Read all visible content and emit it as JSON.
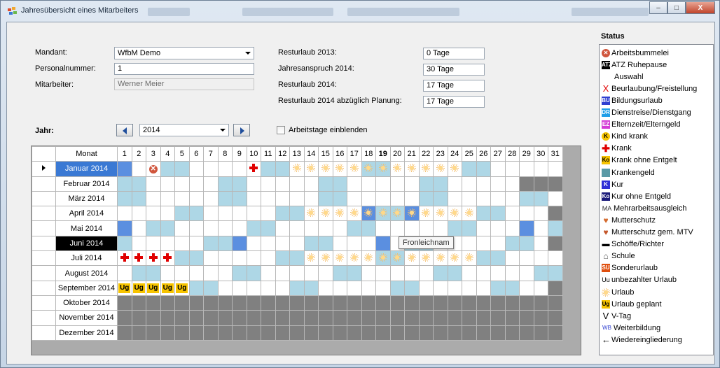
{
  "window": {
    "title": "Jahresübersicht eines Mitarbeiters",
    "controls": {
      "minimize": "–",
      "maximize": "□",
      "close": "X"
    }
  },
  "form": {
    "mandant_label": "Mandant:",
    "mandant_value": "WfbM Demo",
    "personalnummer_label": "Personalnummer:",
    "personalnummer_value": "1",
    "mitarbeiter_label": "Mitarbeiter:",
    "mitarbeiter_value": "Werner Meier",
    "resturlaub_prev_label": "Resturlaub 2013:",
    "resturlaub_prev_value": "0 Tage",
    "jahresanspruch_label": "Jahresanspruch 2014:",
    "jahresanspruch_value": "30 Tage",
    "resturlaub_label": "Resturlaub 2014:",
    "resturlaub_value": "17 Tage",
    "resturlaub_planung_label": "Resturlaub 2014 abzüglich Planung:",
    "resturlaub_planung_value": "17 Tage",
    "jahr_label": "Jahr:",
    "jahr_value": "2014",
    "arbeitstage_label": "Arbeitstage einblenden",
    "arbeitstage_checked": false
  },
  "grid": {
    "month_header": "Monat",
    "days": [
      "1",
      "2",
      "3",
      "4",
      "5",
      "6",
      "7",
      "8",
      "9",
      "10",
      "11",
      "12",
      "13",
      "14",
      "15",
      "16",
      "17",
      "18",
      "19",
      "20",
      "21",
      "22",
      "23",
      "24",
      "25",
      "26",
      "27",
      "28",
      "29",
      "30",
      "31"
    ],
    "current_day": "19",
    "months": [
      {
        "name": "Januar 2014",
        "days_in_month": 31,
        "weekend": [
          4,
          5,
          11,
          12,
          18,
          19,
          25,
          26
        ],
        "marks": {
          "1": "dblue",
          "3": "bummel",
          "10": "krank",
          "13": "urlaub",
          "14": "urlaub",
          "15": "urlaub",
          "16": "urlaub",
          "17": "urlaub",
          "18": "urlaub",
          "19": "urlaub",
          "20": "urlaub",
          "21": "urlaub",
          "22": "urlaub",
          "23": "urlaub",
          "24": "urlaub"
        }
      },
      {
        "name": "Februar 2014",
        "days_in_month": 28,
        "weekend": [
          1,
          2,
          8,
          9,
          15,
          16,
          22,
          23
        ],
        "marks": {}
      },
      {
        "name": "März 2014",
        "days_in_month": 31,
        "weekend": [
          1,
          2,
          8,
          9,
          15,
          16,
          22,
          23,
          29,
          30
        ],
        "marks": {}
      },
      {
        "name": "April 2014",
        "days_in_month": 30,
        "weekend": [
          5,
          6,
          12,
          13,
          19,
          20,
          26,
          27
        ],
        "marks": {
          "14": "urlaub",
          "15": "urlaub",
          "16": "urlaub",
          "17": "urlaub",
          "18": "urlaub-dblue",
          "19": "urlaub",
          "20": "urlaub",
          "21": "urlaub-dblue",
          "22": "urlaub",
          "23": "urlaub",
          "24": "urlaub",
          "25": "urlaub"
        }
      },
      {
        "name": "Mai 2014",
        "days_in_month": 31,
        "weekend": [
          3,
          4,
          10,
          11,
          17,
          18,
          24,
          25,
          31
        ],
        "marks": {
          "1": "dblue",
          "29": "dblue"
        }
      },
      {
        "name": "Juni 2014",
        "days_in_month": 30,
        "weekend": [
          1,
          7,
          8,
          14,
          15,
          21,
          22,
          28,
          29
        ],
        "marks": {
          "9": "dblue",
          "19": "dblue"
        }
      },
      {
        "name": "Juli 2014",
        "days_in_month": 31,
        "weekend": [
          5,
          6,
          12,
          13,
          19,
          20,
          26,
          27
        ],
        "marks": {
          "1": "krank",
          "2": "krank",
          "3": "krank",
          "4": "krank",
          "14": "urlaub",
          "15": "urlaub",
          "16": "urlaub",
          "17": "urlaub",
          "18": "urlaub",
          "19": "urlaub",
          "20": "urlaub",
          "21": "urlaub",
          "22": "urlaub",
          "23": "urlaub",
          "24": "urlaub",
          "25": "urlaub"
        }
      },
      {
        "name": "August 2014",
        "days_in_month": 31,
        "weekend": [
          2,
          3,
          9,
          10,
          16,
          17,
          23,
          24,
          30,
          31
        ],
        "marks": {}
      },
      {
        "name": "September 2014",
        "days_in_month": 30,
        "weekend": [
          6,
          7,
          13,
          14,
          20,
          21,
          27,
          28
        ],
        "marks": {
          "1": "ug",
          "2": "ug",
          "3": "ug",
          "4": "ug",
          "5": "ug"
        }
      },
      {
        "name": "Oktober 2014",
        "days_in_month": 0,
        "weekend": [],
        "marks": {}
      },
      {
        "name": "November 2014",
        "days_in_month": 0,
        "weekend": [],
        "marks": {}
      },
      {
        "name": "Dezember 2014",
        "days_in_month": 0,
        "weekend": [],
        "marks": {}
      }
    ],
    "current_row": 0,
    "highlight_row": 5,
    "ug_label": "Ug",
    "bummel_label": "✕",
    "tooltip": "Fronleichnam"
  },
  "status": {
    "title": "Status",
    "items": [
      {
        "label": "Arbeitsbummelei",
        "icon": "bummelei-icon",
        "code": "",
        "color": "#d0553c"
      },
      {
        "label": "ATZ Ruhepause",
        "icon": "atz-icon",
        "code": "ATZ",
        "color": "#000000"
      },
      {
        "label": "Auswahl",
        "icon": "auswahl-icon",
        "code": "",
        "color": ""
      },
      {
        "label": "Beurlaubung/Freistellung",
        "icon": "x-icon",
        "code": "X",
        "color": "#e00000"
      },
      {
        "label": "Bildungsurlaub",
        "icon": "bildungsurlaub-icon",
        "code": "BU",
        "color": "#2f3fd1"
      },
      {
        "label": "Dienstreise/Dienstgang",
        "icon": "dienstreise-icon",
        "code": "DR",
        "color": "#1f9ee8"
      },
      {
        "label": "Elternzeit/Elterngeld",
        "icon": "elternzeit-icon",
        "code": "EZ",
        "color": "#d43bd6"
      },
      {
        "label": "Kind krank",
        "icon": "kind-krank-icon",
        "code": "K",
        "color": "#f7c400"
      },
      {
        "label": "Krank",
        "icon": "krank-icon",
        "code": "",
        "color": "#e00000"
      },
      {
        "label": "Krank ohne Entgelt",
        "icon": "krank-ohne-entgelt-icon",
        "code": "Ko",
        "color": "#f7c400"
      },
      {
        "label": "Krankengeld",
        "icon": "krankengeld-icon",
        "code": "",
        "color": "#5a9aa6"
      },
      {
        "label": "Kur",
        "icon": "kur-icon",
        "code": "K",
        "color": "#2f2fd6"
      },
      {
        "label": "Kur ohne Entgeld",
        "icon": "kur-ohne-entgeld-icon",
        "code": "Ko",
        "color": "#1a1a7a"
      },
      {
        "label": "Mehrarbeitsausgleich",
        "icon": "mehrarbeit-icon",
        "code": "MA",
        "color": ""
      },
      {
        "label": "Mutterschutz",
        "icon": "mutterschutz-icon",
        "code": "",
        "color": "#d46a2e"
      },
      {
        "label": "Mutterschutz gem. MTV",
        "icon": "mutterschutz-mtv-icon",
        "code": "",
        "color": "#c4562a"
      },
      {
        "label": "Schöffe/Richter",
        "icon": "schoeffe-icon",
        "code": "",
        "color": "#000000"
      },
      {
        "label": "Schule",
        "icon": "schule-icon",
        "code": "",
        "color": ""
      },
      {
        "label": "Sonderurlaub",
        "icon": "sonderurlaub-icon",
        "code": "SU",
        "color": "#e05010"
      },
      {
        "label": "unbezahlter Urlaub",
        "icon": "unbezahlt-icon",
        "code": "Uu",
        "color": ""
      },
      {
        "label": "Urlaub",
        "icon": "urlaub-icon",
        "code": "",
        "color": "#f6bd67"
      },
      {
        "label": "Urlaub geplant",
        "icon": "urlaub-geplant-icon",
        "code": "Ug",
        "color": "#f7c400"
      },
      {
        "label": "V-Tag",
        "icon": "v-tag-icon",
        "code": "V",
        "color": ""
      },
      {
        "label": "Weiterbildung",
        "icon": "weiterbildung-icon",
        "code": "WB",
        "color": "#2f3fd1"
      },
      {
        "label": "Wiedereingliederung",
        "icon": "wiedereingliederung-icon",
        "code": "←",
        "color": "#000000"
      }
    ]
  }
}
